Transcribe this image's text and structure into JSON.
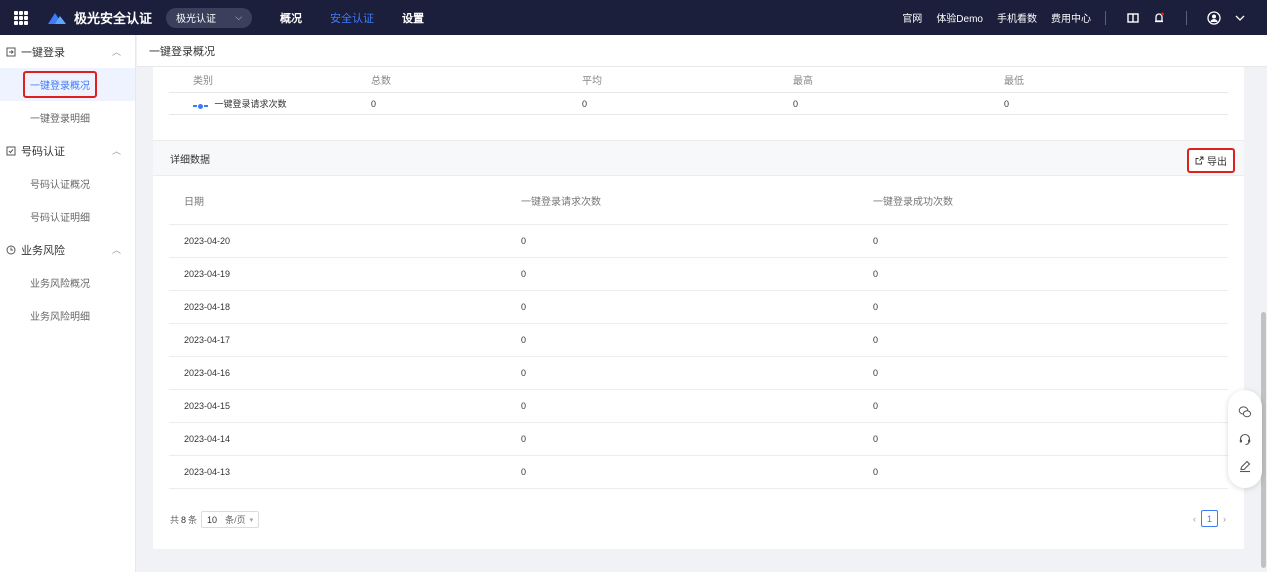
{
  "topbar": {
    "logo_text": "极光安全认证",
    "product_select": "极光认证",
    "nav": [
      {
        "label": "概况",
        "active": false
      },
      {
        "label": "安全认证",
        "active": true
      },
      {
        "label": "设置",
        "active": false
      }
    ],
    "links": [
      "官网",
      "体验Demo",
      "手机看数",
      "费用中心"
    ]
  },
  "sidebar": {
    "groups": [
      {
        "label": "一键登录",
        "items": [
          "一键登录概况",
          "一键登录明细"
        ],
        "active_item": "一键登录概况"
      },
      {
        "label": "号码认证",
        "items": [
          "号码认证概况",
          "号码认证明细"
        ]
      },
      {
        "label": "业务风险",
        "items": [
          "业务风险概况",
          "业务风险明细"
        ]
      }
    ]
  },
  "main": {
    "title": "一键登录概况",
    "summary": {
      "headers": [
        "类别",
        "总数",
        "平均",
        "最高",
        "最低"
      ],
      "rows": [
        {
          "category": "一键登录请求次数",
          "total": "0",
          "avg": "0",
          "max": "0",
          "min": "0"
        }
      ]
    },
    "detail": {
      "title": "详细数据",
      "export_label": "导出",
      "headers": [
        "日期",
        "一键登录请求次数",
        "一键登录成功次数"
      ],
      "rows": [
        {
          "date": "2023-04-20",
          "requests": "0",
          "success": "0"
        },
        {
          "date": "2023-04-19",
          "requests": "0",
          "success": "0"
        },
        {
          "date": "2023-04-18",
          "requests": "0",
          "success": "0"
        },
        {
          "date": "2023-04-17",
          "requests": "0",
          "success": "0"
        },
        {
          "date": "2023-04-16",
          "requests": "0",
          "success": "0"
        },
        {
          "date": "2023-04-15",
          "requests": "0",
          "success": "0"
        },
        {
          "date": "2023-04-14",
          "requests": "0",
          "success": "0"
        },
        {
          "date": "2023-04-13",
          "requests": "0",
          "success": "0"
        }
      ]
    },
    "pager": {
      "total_prefix": "共",
      "total_count": "8",
      "total_suffix": "条",
      "page_size": "10",
      "page_size_unit": "条/页",
      "current_page": "1"
    }
  },
  "colors": {
    "topbar_bg": "#1b1f3b",
    "accent": "#3e7bfa",
    "highlight_border": "#e0201c"
  },
  "icons": [
    "apps-grid-icon",
    "brand-logo-icon",
    "chevron-down-icon",
    "layout-icon",
    "bell-icon",
    "user-icon",
    "login-icon",
    "phone-check-icon",
    "clock-icon",
    "export-icon",
    "wechat-icon",
    "headset-icon",
    "edit-icon"
  ]
}
